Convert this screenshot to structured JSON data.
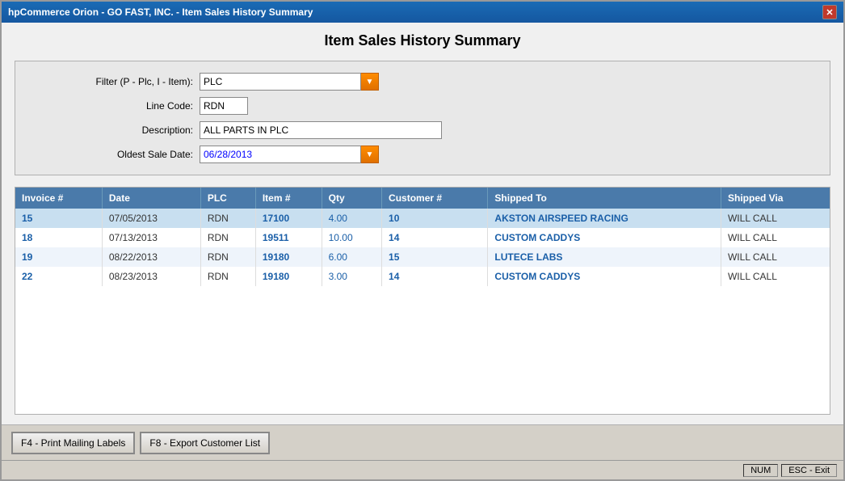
{
  "window": {
    "title": "hpCommerce Orion - GO FAST, INC. - Item Sales History Summary",
    "close_label": "✕"
  },
  "page": {
    "title": "Item Sales History Summary"
  },
  "filters": {
    "filter_label": "Filter (P - Plc, I - Item):",
    "filter_value": "PLC",
    "linecode_label": "Line Code:",
    "linecode_value": "RDN",
    "description_label": "Description:",
    "description_value": "ALL PARTS IN PLC",
    "oldest_sale_label": "Oldest Sale Date:",
    "oldest_sale_value": "06/28/2013"
  },
  "table": {
    "columns": [
      {
        "id": "invoice",
        "label": "Invoice #"
      },
      {
        "id": "date",
        "label": "Date"
      },
      {
        "id": "plc",
        "label": "PLC"
      },
      {
        "id": "item",
        "label": "Item #"
      },
      {
        "id": "qty",
        "label": "Qty"
      },
      {
        "id": "customer",
        "label": "Customer #"
      },
      {
        "id": "shipped_to",
        "label": "Shipped To"
      },
      {
        "id": "shipped_via",
        "label": "Shipped Via"
      }
    ],
    "rows": [
      {
        "invoice": "15",
        "date": "07/05/2013",
        "plc": "RDN",
        "item": "17100",
        "qty": "4.00",
        "customer": "10",
        "shipped_to": "AKSTON AIRSPEED RACING",
        "shipped_via": "WILL CALL",
        "selected": true
      },
      {
        "invoice": "18",
        "date": "07/13/2013",
        "plc": "RDN",
        "item": "19511",
        "qty": "10.00",
        "customer": "14",
        "shipped_to": "CUSTOM CADDYS",
        "shipped_via": "WILL CALL",
        "selected": false
      },
      {
        "invoice": "19",
        "date": "08/22/2013",
        "plc": "RDN",
        "item": "19180",
        "qty": "6.00",
        "customer": "15",
        "shipped_to": "LUTECE LABS",
        "shipped_via": "WILL CALL",
        "selected": false
      },
      {
        "invoice": "22",
        "date": "08/23/2013",
        "plc": "RDN",
        "item": "19180",
        "qty": "3.00",
        "customer": "14",
        "shipped_to": "CUSTOM CADDYS",
        "shipped_via": "WILL CALL",
        "selected": false
      }
    ]
  },
  "buttons": [
    {
      "id": "print-mailing",
      "label": "F4 - Print Mailing Labels"
    },
    {
      "id": "export-customer",
      "label": "F8 - Export Customer List"
    }
  ],
  "status": {
    "num": "NUM",
    "esc": "ESC - Exit"
  }
}
